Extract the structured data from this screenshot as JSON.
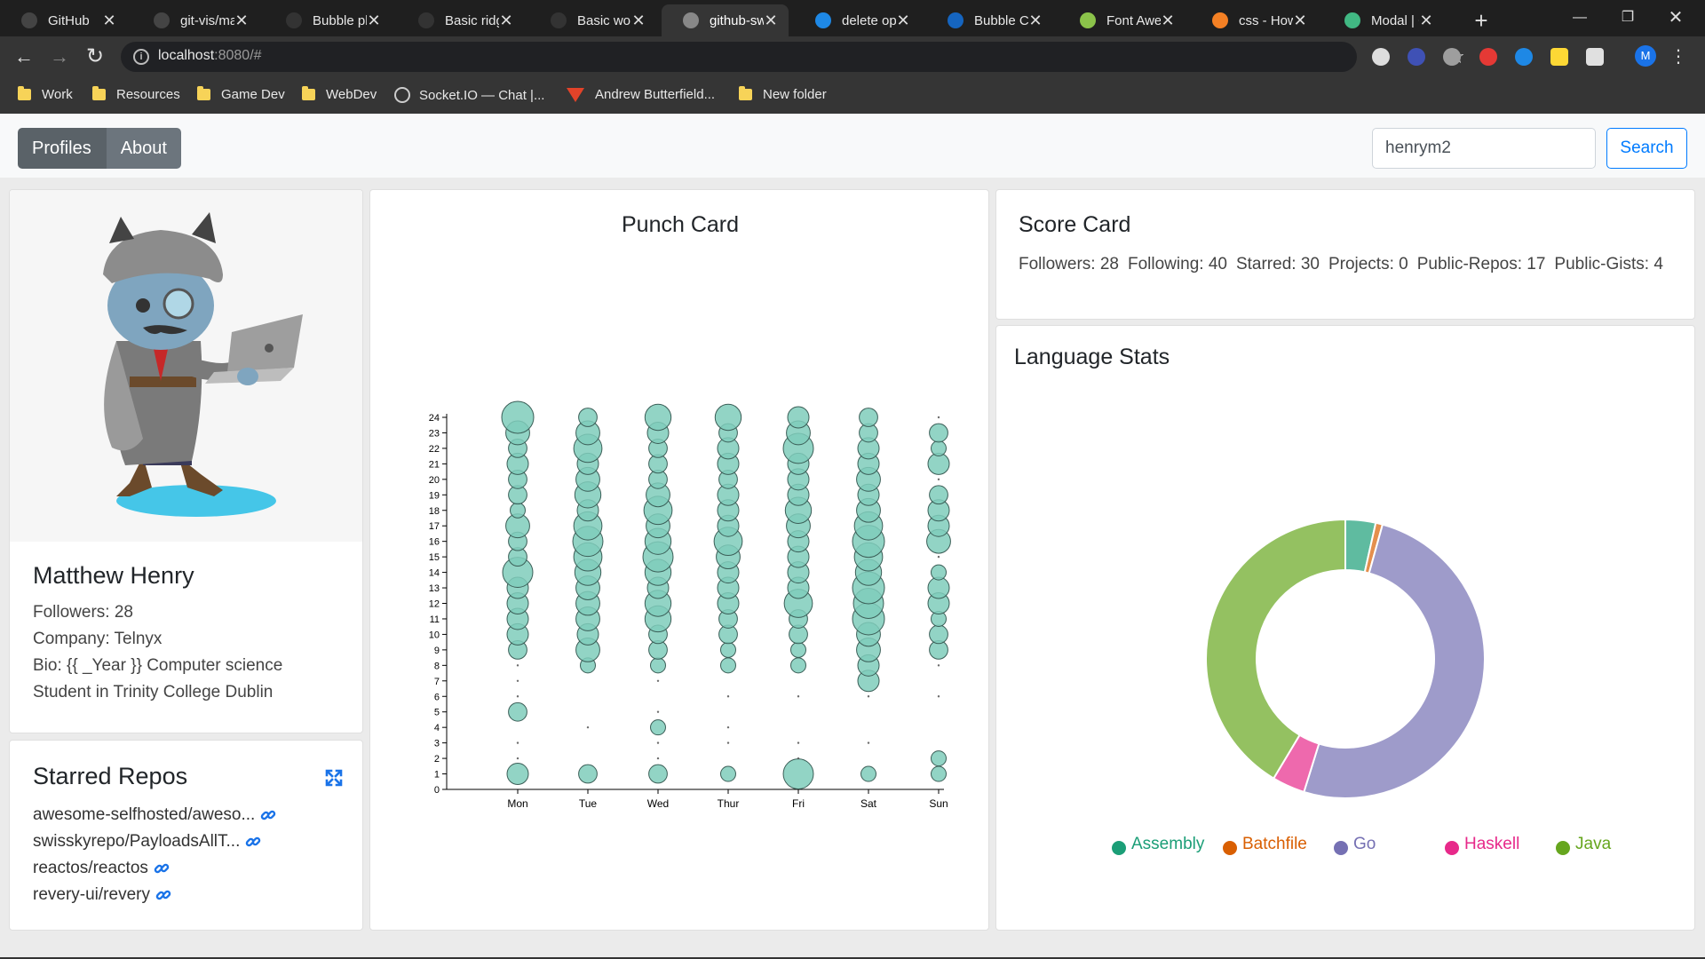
{
  "browser": {
    "tabs": [
      {
        "title": "GitHub",
        "active": false,
        "color": "#444"
      },
      {
        "title": "git-vis/ma",
        "active": false,
        "color": "#444"
      },
      {
        "title": "Bubble plo",
        "active": false,
        "color": "#333"
      },
      {
        "title": "Basic ridge",
        "active": false,
        "color": "#333"
      },
      {
        "title": "Basic word",
        "active": false,
        "color": "#333"
      },
      {
        "title": "github-sw",
        "active": true,
        "color": "#888"
      },
      {
        "title": "delete opt",
        "active": false,
        "color": "#1e88e5"
      },
      {
        "title": "Bubble Ch",
        "active": false,
        "color": "#1565c0"
      },
      {
        "title": "Font Awes",
        "active": false,
        "color": "#8bc34a"
      },
      {
        "title": "css - How",
        "active": false,
        "color": "#f48024"
      },
      {
        "title": "Modal | Co",
        "active": false,
        "color": "#41b883"
      }
    ],
    "url_host": "localhost",
    "url_rest": ":8080/#",
    "profile_initial": "M",
    "bookmarks": [
      {
        "label": "Work",
        "icon": "folder-icon"
      },
      {
        "label": "Resources",
        "icon": "folder-icon"
      },
      {
        "label": "Game Dev",
        "icon": "folder-icon"
      },
      {
        "label": "WebDev",
        "icon": "folder-icon"
      },
      {
        "label": "Socket.IO — Chat |...",
        "icon": "socketio-icon"
      },
      {
        "label": "Andrew Butterfield...",
        "icon": "gitlab-icon"
      },
      {
        "label": "New folder",
        "icon": "folder-icon"
      }
    ]
  },
  "nav": {
    "profiles_label": "Profiles",
    "about_label": "About",
    "search_value": "henrym2",
    "search_button": "Search"
  },
  "profile": {
    "name": "Matthew Henry",
    "followers": "Followers: 28",
    "company": "Company: Telnyx",
    "bio_line1": "Bio: {{ _Year }} Computer science",
    "bio_line2": "Student in Trinity College Dublin"
  },
  "starred": {
    "title": "Starred Repos",
    "repos": [
      "awesome-selfhosted/aweso...",
      "swisskyrepo/PayloadsAllT...",
      "reactos/reactos",
      "revery-ui/revery"
    ]
  },
  "score": {
    "title": "Score Card",
    "items": [
      "Followers: 28",
      "Following: 40",
      "Starred: 30",
      "Projects: 0",
      "Public-Repos: 17",
      "Public-Gists: 4"
    ]
  },
  "punch": {
    "title": "Punch Card"
  },
  "language": {
    "title": "Language Stats"
  },
  "chart_data": [
    {
      "type": "scatter",
      "title": "Punch Card",
      "x_categories": [
        "Mon",
        "Tue",
        "Wed",
        "Thur",
        "Fri",
        "Sat",
        "Sun"
      ],
      "y_ticks": [
        0,
        1,
        2,
        3,
        4,
        5,
        6,
        7,
        8,
        9,
        10,
        11,
        12,
        13,
        14,
        15,
        16,
        17,
        18,
        19,
        20,
        21,
        22,
        23,
        24
      ],
      "ylim": [
        0,
        24
      ],
      "point_color": "#7fcdbb",
      "size_encodes": "commit count (relative)",
      "series": [
        {
          "name": "Mon",
          "values": [
            0,
            4,
            1,
            1,
            0,
            3,
            1,
            1,
            1,
            3,
            4,
            4,
            4,
            4,
            8,
            3,
            3,
            5,
            2,
            3,
            3,
            4,
            3,
            5,
            9
          ]
        },
        {
          "name": "Tue",
          "values": [
            0,
            3,
            0,
            0,
            1,
            0,
            0,
            0,
            2,
            5,
            4,
            5,
            5,
            5,
            6,
            7,
            8,
            7,
            4,
            6,
            5,
            4,
            7,
            5,
            3
          ]
        },
        {
          "name": "Wed",
          "values": [
            0,
            3,
            1,
            1,
            2,
            1,
            0,
            1,
            2,
            3,
            3,
            6,
            6,
            4,
            6,
            8,
            6,
            5,
            7,
            5,
            3,
            3,
            3,
            4,
            6
          ]
        },
        {
          "name": "Thur",
          "values": [
            0,
            2,
            0,
            1,
            1,
            0,
            1,
            0,
            2,
            2,
            3,
            3,
            4,
            4,
            4,
            5,
            7,
            4,
            4,
            4,
            3,
            4,
            4,
            3,
            6
          ]
        },
        {
          "name": "Fri",
          "values": [
            0,
            8,
            1,
            1,
            0,
            0,
            1,
            0,
            2,
            2,
            3,
            3,
            7,
            4,
            4,
            4,
            4,
            5,
            6,
            4,
            4,
            4,
            8,
            5,
            4
          ]
        },
        {
          "name": "Sat",
          "values": [
            0,
            2,
            0,
            1,
            0,
            0,
            1,
            4,
            4,
            5,
            5,
            9,
            8,
            9,
            6,
            7,
            9,
            7,
            5,
            4,
            5,
            4,
            4,
            3,
            3
          ]
        },
        {
          "name": "Sun",
          "values": [
            0,
            2,
            2,
            0,
            0,
            0,
            1,
            0,
            1,
            3,
            3,
            2,
            4,
            4,
            2,
            1,
            5,
            4,
            4,
            3,
            1,
            4,
            2,
            3,
            1
          ]
        }
      ]
    },
    {
      "type": "pie",
      "title": "Language Stats",
      "donut": true,
      "categories": [
        "Assembly",
        "Batchfile",
        "Go",
        "Haskell",
        "Java"
      ],
      "values": [
        3.5,
        0.8,
        50.5,
        3.8,
        41.4
      ],
      "colors": [
        "#1b9e77",
        "#d95f02",
        "#7570b3",
        "#e7298a",
        "#66a61e"
      ],
      "legend": "bottom"
    }
  ]
}
